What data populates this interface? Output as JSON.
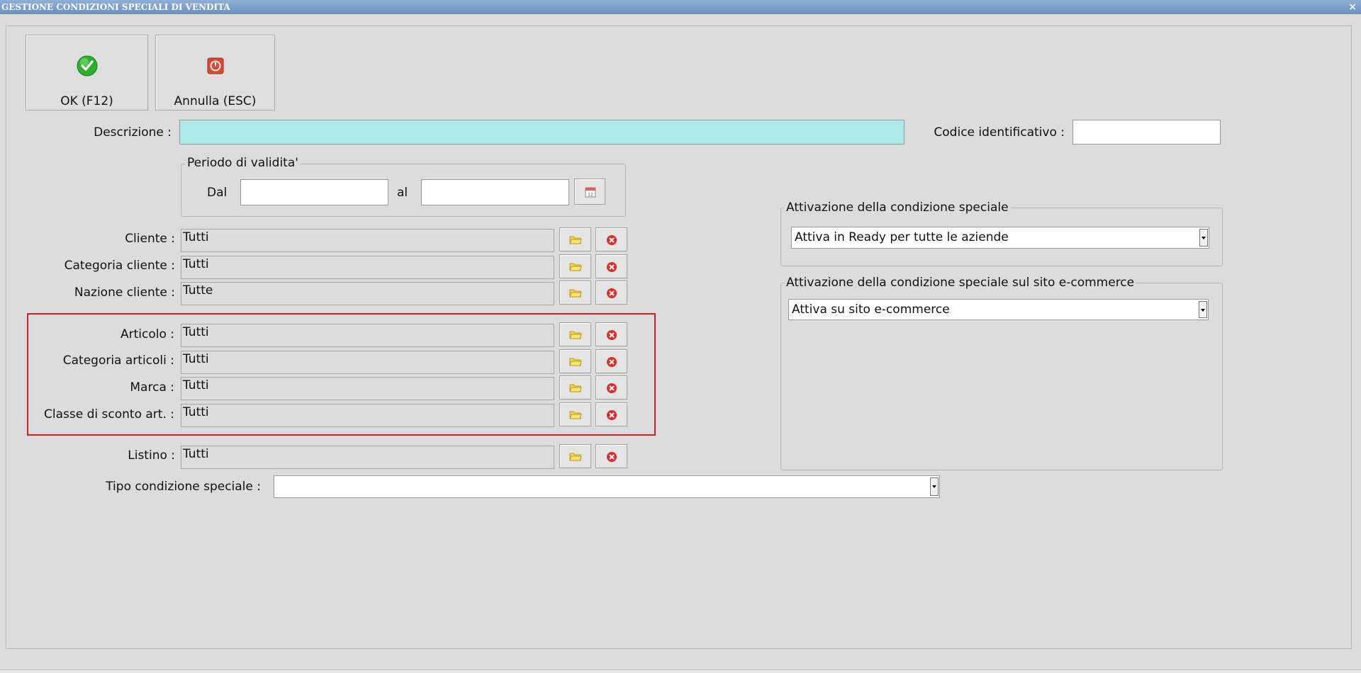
{
  "window": {
    "title": "GESTIONE CONDIZIONI SPECIALI DI VENDITA",
    "close_glyph": "×"
  },
  "toolbar": {
    "ok_label": "OK (F12)",
    "cancel_label": "Annulla (ESC)"
  },
  "form": {
    "descrizione_label": "Descrizione :",
    "descrizione_value": "",
    "codice_label": "Codice identificativo :",
    "codice_value": "",
    "periodo": {
      "legend": "Periodo di validita'",
      "dal_label": "Dal",
      "dal_value": "",
      "al_label": "al",
      "al_value": ""
    },
    "cliente_label": "Cliente :",
    "cliente_value": "Tutti",
    "categoria_cliente_label": "Categoria cliente :",
    "categoria_cliente_value": "Tutti",
    "nazione_cliente_label": "Nazione cliente :",
    "nazione_cliente_value": "Tutte",
    "articolo_label": "Articolo :",
    "articolo_value": "Tutti",
    "categoria_articoli_label": "Categoria articoli :",
    "categoria_articoli_value": "Tutti",
    "marca_label": "Marca :",
    "marca_value": "Tutti",
    "classe_sconto_label": "Classe di sconto art. :",
    "classe_sconto_value": "Tutti",
    "listino_label": "Listino :",
    "listino_value": "Tutti",
    "tipo_condizione_label": "Tipo condizione speciale :",
    "tipo_condizione_value": ""
  },
  "attivazione": {
    "legend": "Attivazione della condizione speciale",
    "selected": "Attiva in Ready per tutte le aziende"
  },
  "attivazione_ecommerce": {
    "legend": "Attivazione della condizione speciale sul sito e-commerce",
    "selected": "Attiva su sito e-commerce"
  },
  "colors": {
    "background": "#dcdcdc",
    "descrizione_field": "#aeeaea",
    "highlight_border": "#d81f1f",
    "ok_green": "#2fae2f",
    "cancel_red": "#d84a32"
  },
  "icons": {
    "ok": "checkmark-icon",
    "cancel": "stop-icon",
    "calendar": "calendar-icon",
    "browse": "folder-icon",
    "clear": "clear-x-icon"
  }
}
